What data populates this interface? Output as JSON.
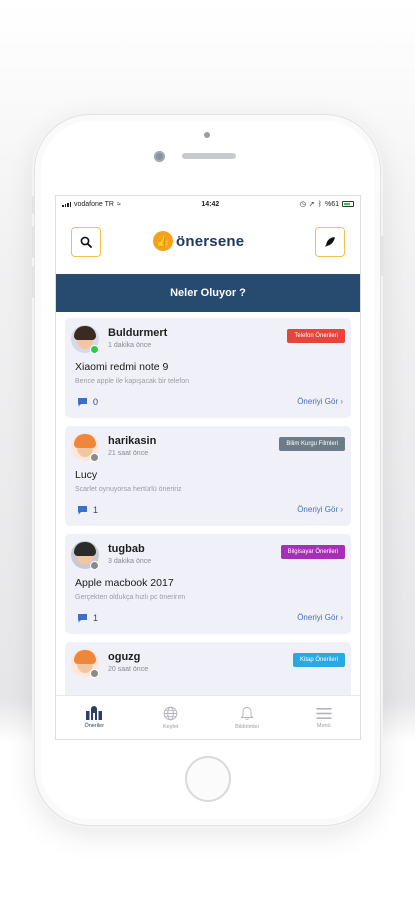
{
  "status_bar": {
    "carrier": "vodafone TR",
    "time": "14:42",
    "battery": "%61"
  },
  "app": {
    "logo_text": "önersene",
    "search_icon": "search-icon",
    "compose_icon": "feather-icon"
  },
  "banner": {
    "title": "Neler Oluyor ?"
  },
  "posts": [
    {
      "username": "Buldurmert",
      "time": "1 dakika önce",
      "tag": "Telefon Önerileri",
      "tag_color": "#e8443a",
      "title": "Xiaomi redmi note 9",
      "desc": "Bence apple ile kapışacak bir telefon",
      "comments": "0",
      "see_label": "Öneriyi Gör ›",
      "online": true
    },
    {
      "username": "harikasin",
      "time": "21 saat önce",
      "tag": "Bilim Kurgu Filmleri",
      "tag_color": "#6b7c86",
      "title": "Lucy",
      "desc": "Scarlet oynuyorsa hertürlü öneririz",
      "comments": "1",
      "see_label": "Öneriyi Gör ›",
      "online": false
    },
    {
      "username": "tugbab",
      "time": "3 dakika önce",
      "tag": "Bilgisayar Önerileri",
      "tag_color": "#a62fb8",
      "title": "Apple macbook 2017",
      "desc": "Gerçekten oldukça hızlı pc önerirım",
      "comments": "1",
      "see_label": "Öneriyi Gör ›",
      "online": false
    },
    {
      "username": "oguzg",
      "time": "20 saat önce",
      "tag": "Kitap Önerileri",
      "tag_color": "#2aa8e0",
      "online": false
    }
  ],
  "tabs": [
    {
      "label": "Öneriler",
      "icon": "home-feed-icon"
    },
    {
      "label": "Keşfet",
      "icon": "globe-icon"
    },
    {
      "label": "Bildirimler",
      "icon": "bell-icon"
    },
    {
      "label": "Menü",
      "icon": "menu-icon"
    }
  ],
  "colors": {
    "accent": "#f0c24a",
    "banner": "#264b6e",
    "link": "#4c6fb8"
  }
}
